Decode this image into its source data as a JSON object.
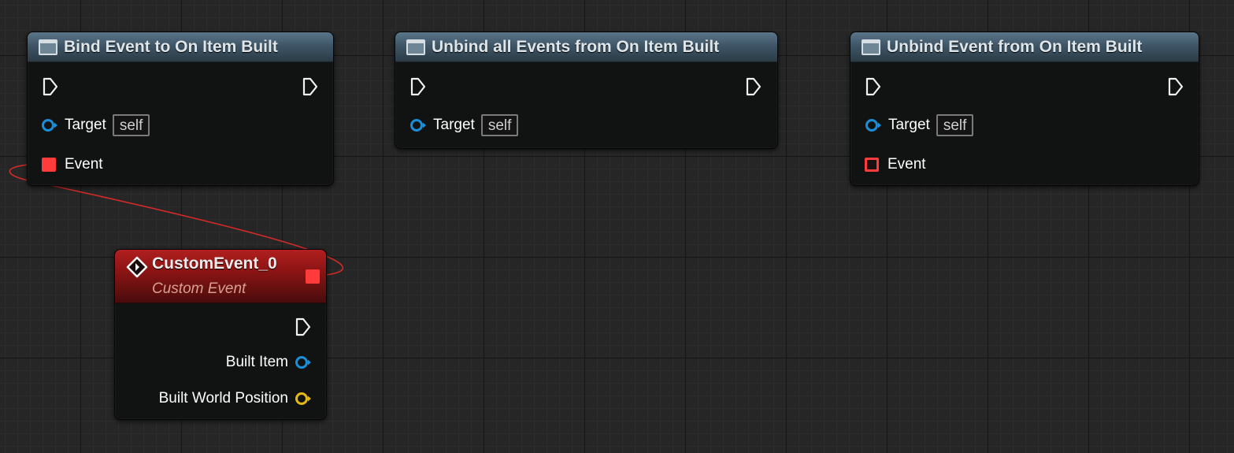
{
  "nodes": {
    "bind": {
      "title": "Bind Event to On Item Built",
      "target_label": "Target",
      "target_default": "self",
      "event_label": "Event"
    },
    "unbind_all": {
      "title": "Unbind all Events from On Item Built",
      "target_label": "Target",
      "target_default": "self"
    },
    "unbind": {
      "title": "Unbind Event from On Item Built",
      "target_label": "Target",
      "target_default": "self",
      "event_label": "Event"
    },
    "custom_event": {
      "title": "CustomEvent_0",
      "subtitle": "Custom Event",
      "outputs": [
        {
          "label": "Built Item",
          "pin_color": "#1a8ed8"
        },
        {
          "label": "Built World Position",
          "pin_color": "#e6b812"
        }
      ]
    }
  },
  "colors": {
    "object_pin": "#1a8ed8",
    "vector_pin": "#e6b812",
    "delegate_pin": "#ff3b3b",
    "wire": "#d42a2a",
    "function_header": "#3f5667",
    "event_header": "#8c1414"
  },
  "icons": {
    "function": "function-icon",
    "custom_event": "event-diamond-icon",
    "exec": "exec-pin-icon"
  }
}
